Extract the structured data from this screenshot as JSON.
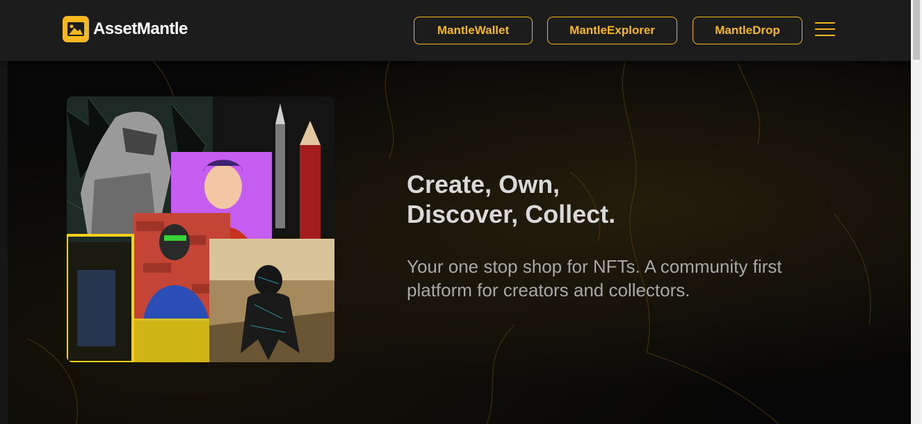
{
  "brand": {
    "name": "AssetMantle",
    "logo_icon": "assetmantle-logo-icon",
    "accent": "#f6b820"
  },
  "nav": {
    "buttons": [
      {
        "label": "MantleWallet"
      },
      {
        "label": "MantleExplorer"
      },
      {
        "label": "MantleDrop"
      }
    ],
    "menu_icon": "hamburger-menu-icon"
  },
  "hero": {
    "headline_line1": "Create, Own,",
    "headline_line2": "Discover, Collect.",
    "subtext": "Your one stop shop for NFTs. A community first platform for creators and collectors."
  },
  "colors": {
    "background": "#0b0b0b",
    "navbar": "#1c1c1c",
    "headline": "#d9d9d9",
    "subtext": "#a7a7a7"
  }
}
